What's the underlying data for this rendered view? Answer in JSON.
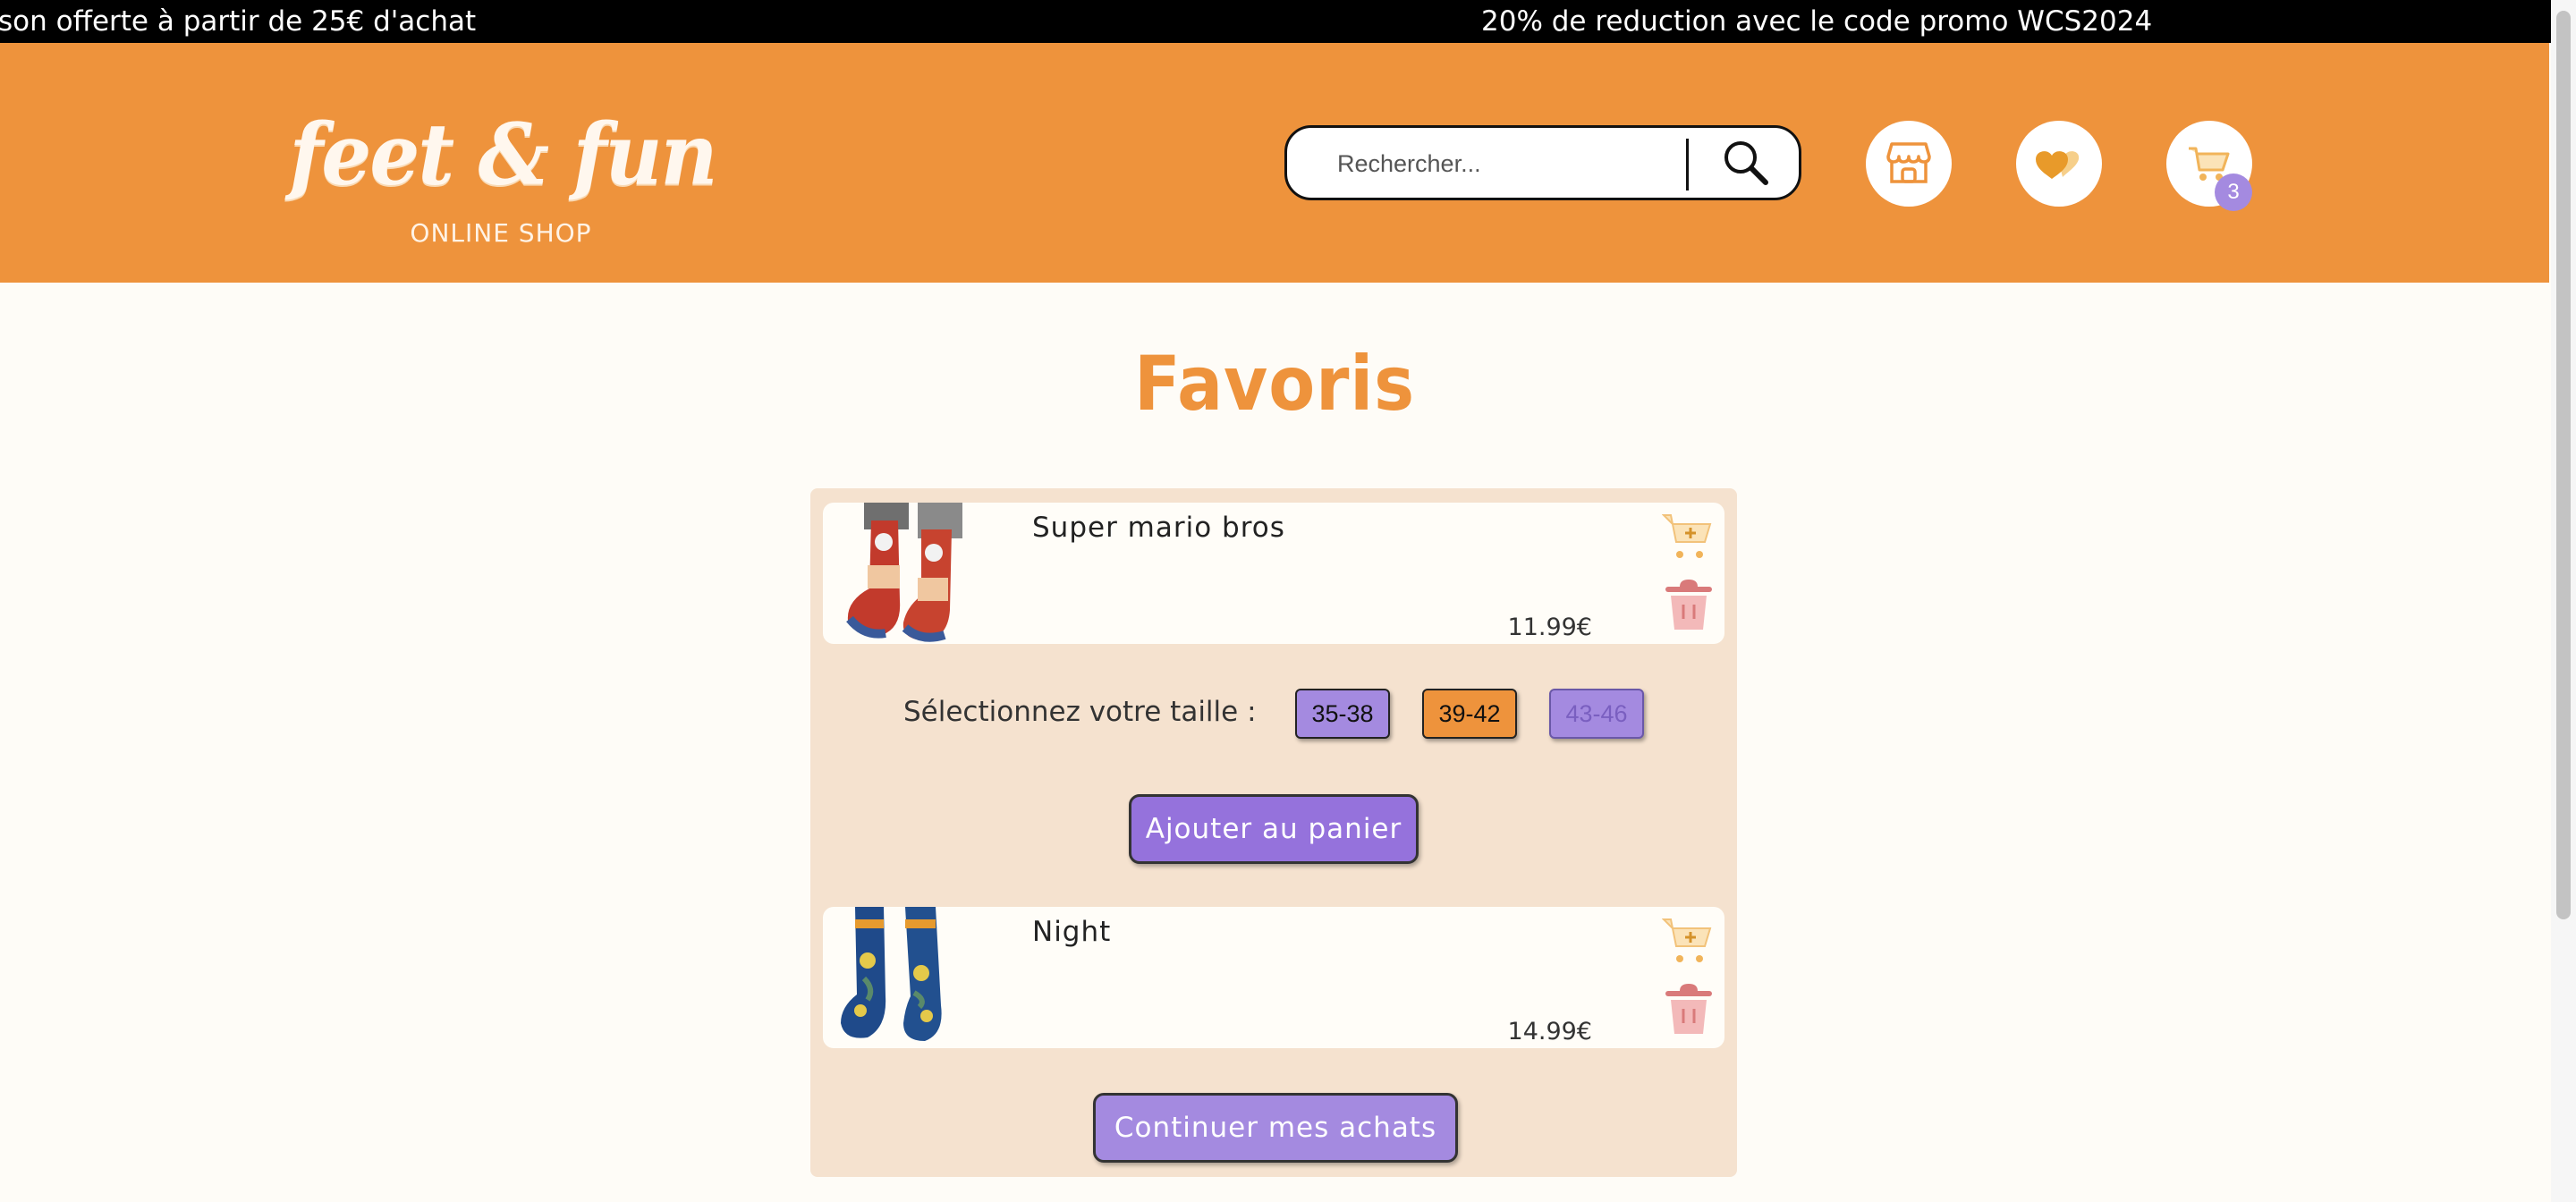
{
  "promo": {
    "left_text": "son offerte à partir de 25€ d'achat",
    "right_text": "20% de reduction avec le code promo WCS2024"
  },
  "header": {
    "logo_title": "feet & fun",
    "logo_subtitle": "ONLINE SHOP",
    "search_placeholder": "Rechercher...",
    "icons": [
      "shop-icon",
      "hearts-icon",
      "cart-icon"
    ],
    "cart_count": "3"
  },
  "page": {
    "title": "Favoris"
  },
  "favorites": [
    {
      "name": "Super mario bros",
      "price": "11.99€"
    },
    {
      "name": "Night",
      "price": "14.99€"
    }
  ],
  "size_picker": {
    "label": "Sélectionnez votre taille :",
    "sizes": [
      "35-38",
      "39-42",
      "43-46"
    ]
  },
  "buttons": {
    "add_to_cart": "Ajouter au panier",
    "continue": "Continuer mes achats"
  },
  "colors": {
    "header_orange": "#ee933c",
    "accent_purple": "#a48ae0",
    "panel_beige": "#f5e2cf"
  }
}
